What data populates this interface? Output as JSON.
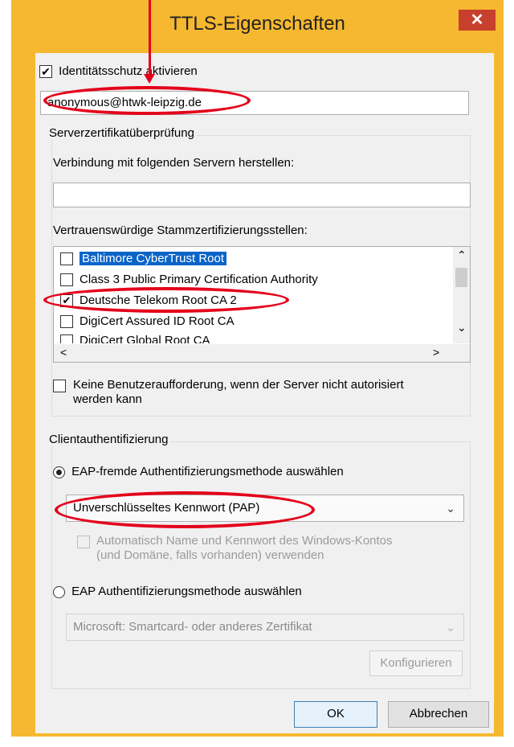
{
  "window": {
    "title": "TTLS-Eigenschaften",
    "close_glyph": "✕"
  },
  "identity": {
    "checkbox_label": "Identitätsschutz aktivieren",
    "checked": true,
    "value": "anonymous@htwk-leipzig.de"
  },
  "server_validation": {
    "group_title": "Serverzertifikatüberprüfung",
    "connect_label": "Verbindung mit folgenden Servern herstellen:",
    "connect_value": "",
    "trusted_label": "Vertrauenswürdige Stammzertifizierungsstellen:",
    "cert_items": [
      {
        "label": "Baltimore CyberTrust Root",
        "checked": false,
        "selected": true
      },
      {
        "label": "Class 3 Public Primary Certification Authority",
        "checked": false,
        "selected": false
      },
      {
        "label": "Deutsche Telekom Root CA 2",
        "checked": true,
        "selected": false
      },
      {
        "label": "DigiCert Assured ID Root CA",
        "checked": false,
        "selected": false
      },
      {
        "label": "DigiCert Global Root CA",
        "checked": false,
        "selected": false
      }
    ],
    "no_prompt_label_line1": "Keine Benutzeraufforderung, wenn der Server nicht autorisiert",
    "no_prompt_label_line2": "werden kann"
  },
  "client_auth": {
    "group_title": "Clientauthentifizierung",
    "non_eap_label": "EAP-fremde Authentifizierungsmethode auswählen",
    "non_eap_selected": true,
    "non_eap_method": "Unverschlüsseltes Kennwort (PAP)",
    "auto_windows_line1": "Automatisch Name und Kennwort des Windows-Kontos",
    "auto_windows_line2": "(und Domäne, falls vorhanden) verwenden",
    "eap_label": "EAP Authentifizierungsmethode auswählen",
    "eap_method": "Microsoft: Smartcard- oder anderes Zertifikat",
    "configure_label": "Konfigurieren"
  },
  "buttons": {
    "ok": "OK",
    "cancel": "Abbrechen"
  },
  "glyphs": {
    "check": "✔",
    "chevron_down": "⌄",
    "scroll_up": "⌃",
    "scroll_down": "⌄",
    "scroll_left": "<",
    "scroll_right": ">"
  },
  "colors": {
    "frame": "#f6b830",
    "close": "#c7402e",
    "annotation": "#e4001a",
    "selection": "#0a64c8"
  }
}
